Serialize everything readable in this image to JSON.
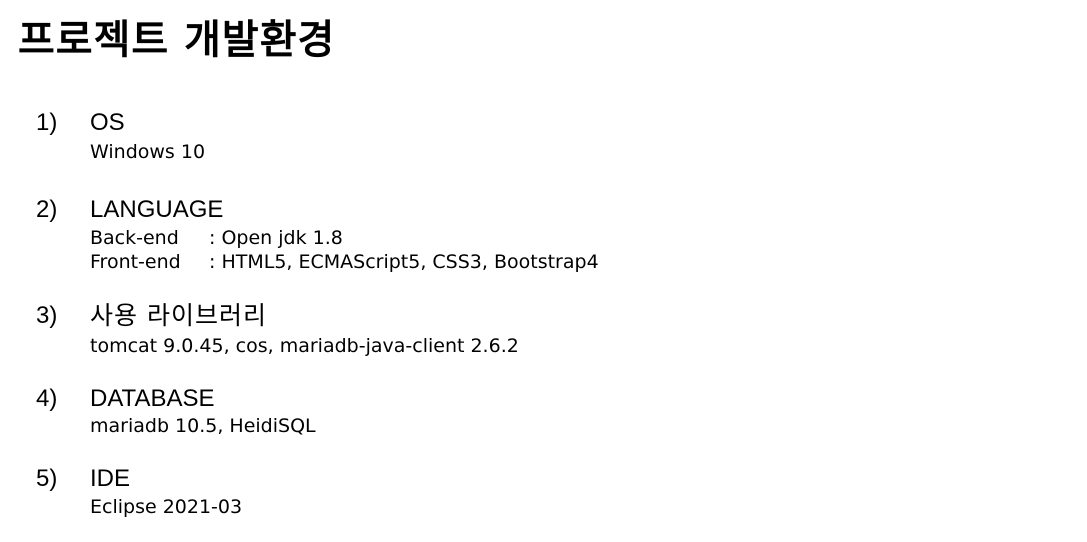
{
  "title": "프로젝트 개발환경",
  "sections": [
    {
      "number": "1)",
      "heading": "OS",
      "detail": "Windows 10"
    },
    {
      "number": "2)",
      "heading": "LANGUAGE",
      "rows": [
        {
          "key": "Back-end",
          "value": ": Open jdk 1.8"
        },
        {
          "key": "Front-end",
          "value": ": HTML5, ECMAScript5, CSS3, Bootstrap4"
        }
      ]
    },
    {
      "number": "3)",
      "heading": "사용 라이브러리",
      "detail": "tomcat 9.0.45, cos, mariadb-java-client 2.6.2"
    },
    {
      "number": "4)",
      "heading": "DATABASE",
      "detail": "mariadb 10.5, HeidiSQL"
    },
    {
      "number": "5)",
      "heading": "IDE",
      "detail": "Eclipse 2021-03"
    }
  ]
}
